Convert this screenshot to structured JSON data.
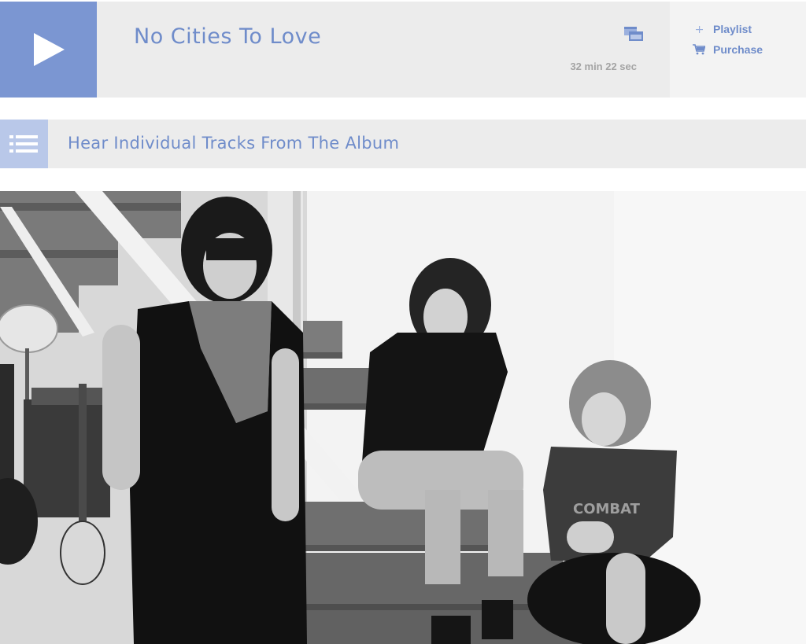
{
  "player": {
    "title": "No Cities To Love",
    "duration": "32 min 22 sec",
    "play_icon": "play-icon",
    "popout_icon": "popout-icon"
  },
  "actions": {
    "playlist": {
      "label": "Playlist",
      "icon": "plus-icon"
    },
    "purchase": {
      "label": "Purchase",
      "icon": "cart-icon"
    }
  },
  "tracks": {
    "label": "Hear Individual Tracks From The Album",
    "icon": "list-icon"
  },
  "photo": {
    "shirt_text": "COMBAT"
  },
  "colors": {
    "accent": "#7b96d2",
    "accent_light": "#b9c8e9",
    "text_blue": "#6f8cca",
    "panel": "#ececec",
    "muted": "#a4a4a4"
  }
}
